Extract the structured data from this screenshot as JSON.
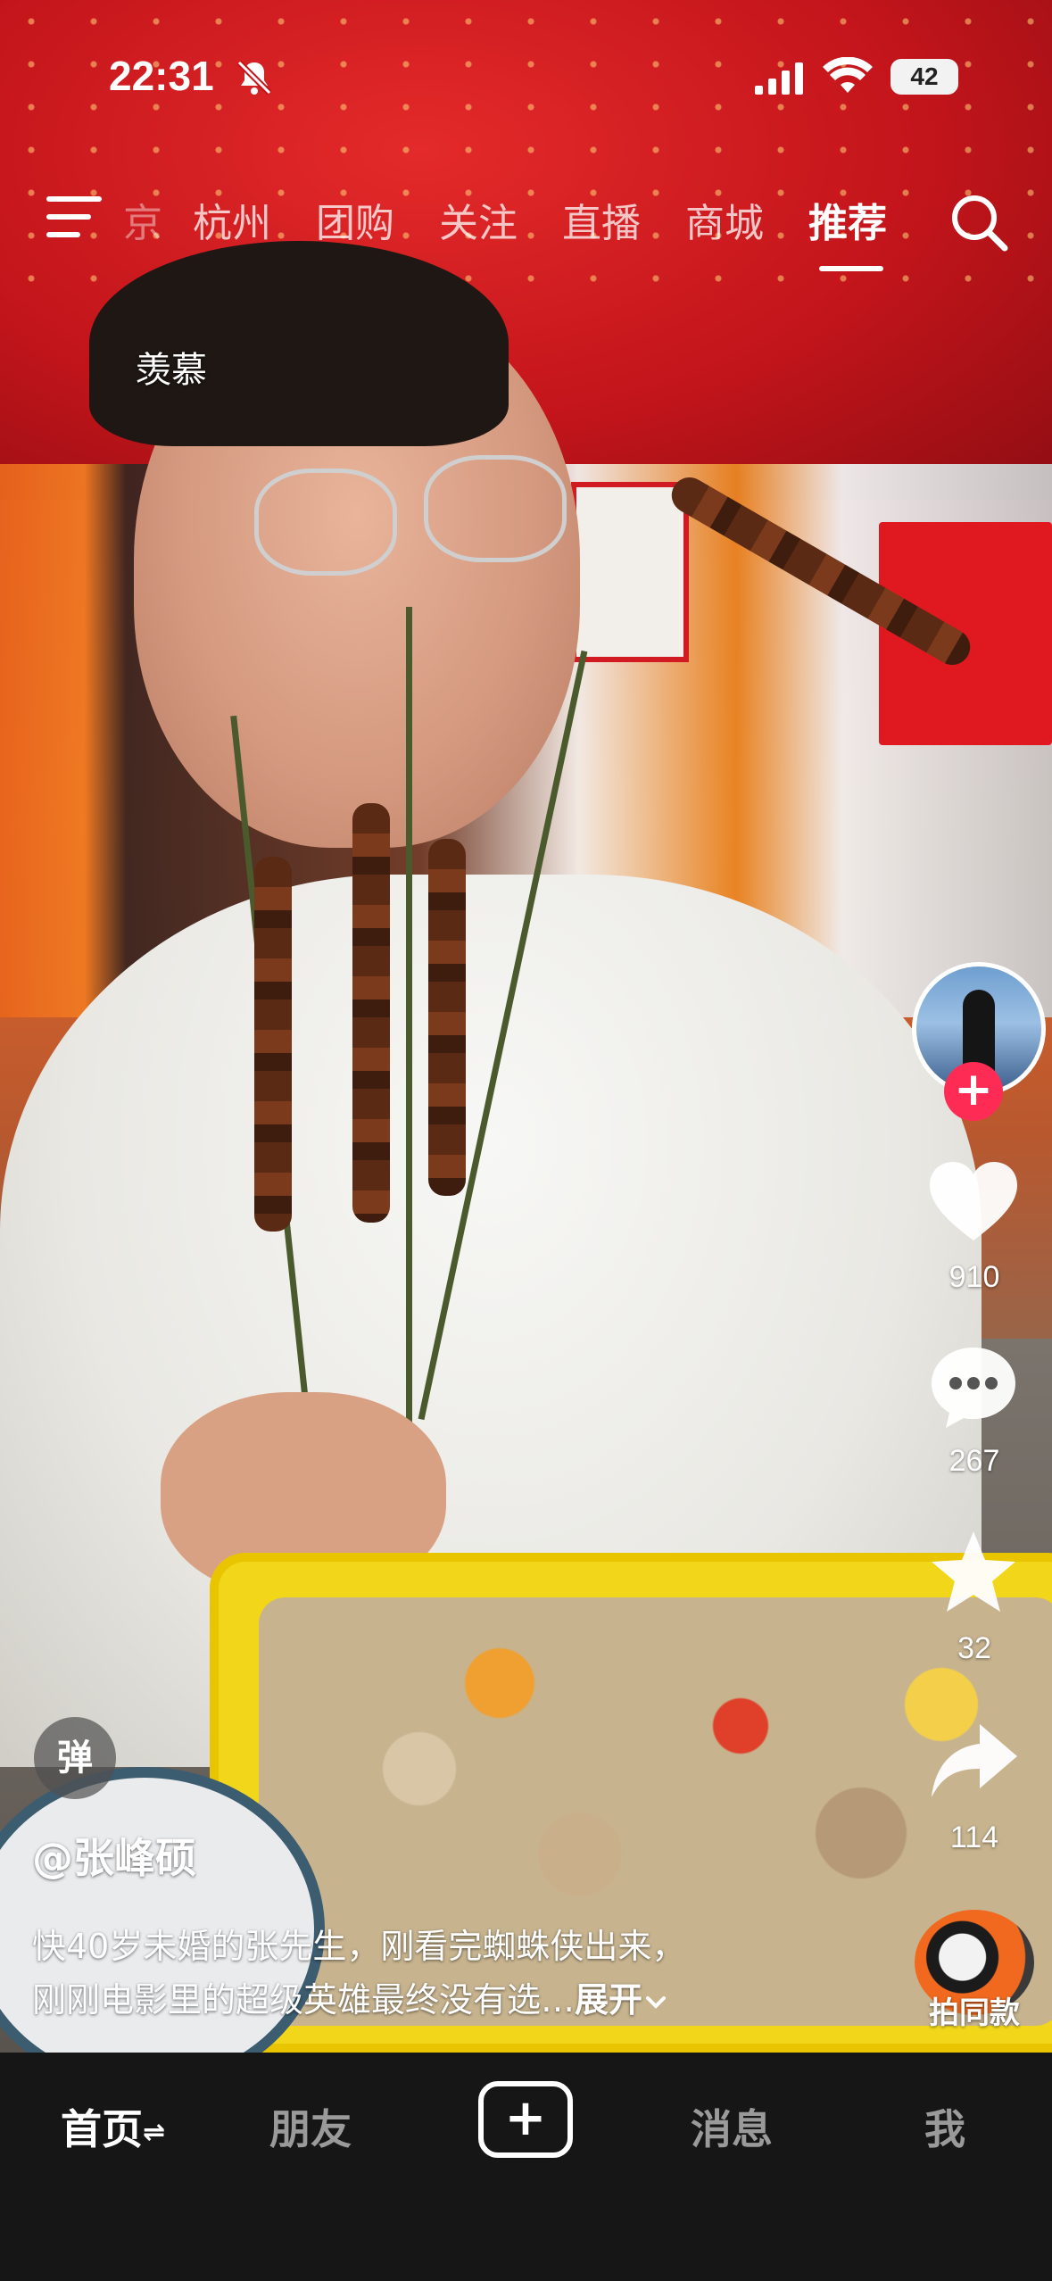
{
  "status_bar": {
    "time": "22:31",
    "battery": "42",
    "icons": [
      "bell-off-icon",
      "signal-icon",
      "wifi-icon",
      "battery-icon"
    ]
  },
  "top_nav": {
    "menu_icon": "menu-icon",
    "tabs": [
      {
        "label": "京"
      },
      {
        "label": "杭州"
      },
      {
        "label": "团购"
      },
      {
        "label": "关注"
      },
      {
        "label": "直播"
      },
      {
        "label": "商城"
      },
      {
        "label": "推荐",
        "active": true
      }
    ],
    "search_icon": "search-icon"
  },
  "danmaku": {
    "text": "羡慕"
  },
  "right_rail": {
    "avatar_icon": "creator-avatar",
    "follow_label": "+",
    "like_count": "910",
    "comment_count": "267",
    "favorite_count": "32",
    "share_count": "114",
    "same_style_label": "拍同款"
  },
  "caption": {
    "danmaku_toggle": "弹",
    "author": "@张峰硕",
    "line1": "快40岁未婚的张先生，刚看完蜘蛛侠出来，",
    "line2": "刚刚电影里的超级英雄最终没有选…",
    "expand": "展开"
  },
  "bottom_bar": {
    "home": "首页",
    "friends": "朋友",
    "create": "+",
    "messages": "消息",
    "me": "我"
  },
  "colors": {
    "accent": "#fe2c55",
    "tabbar_bg": "#161616",
    "inactive_text": "#9a9a9a"
  }
}
